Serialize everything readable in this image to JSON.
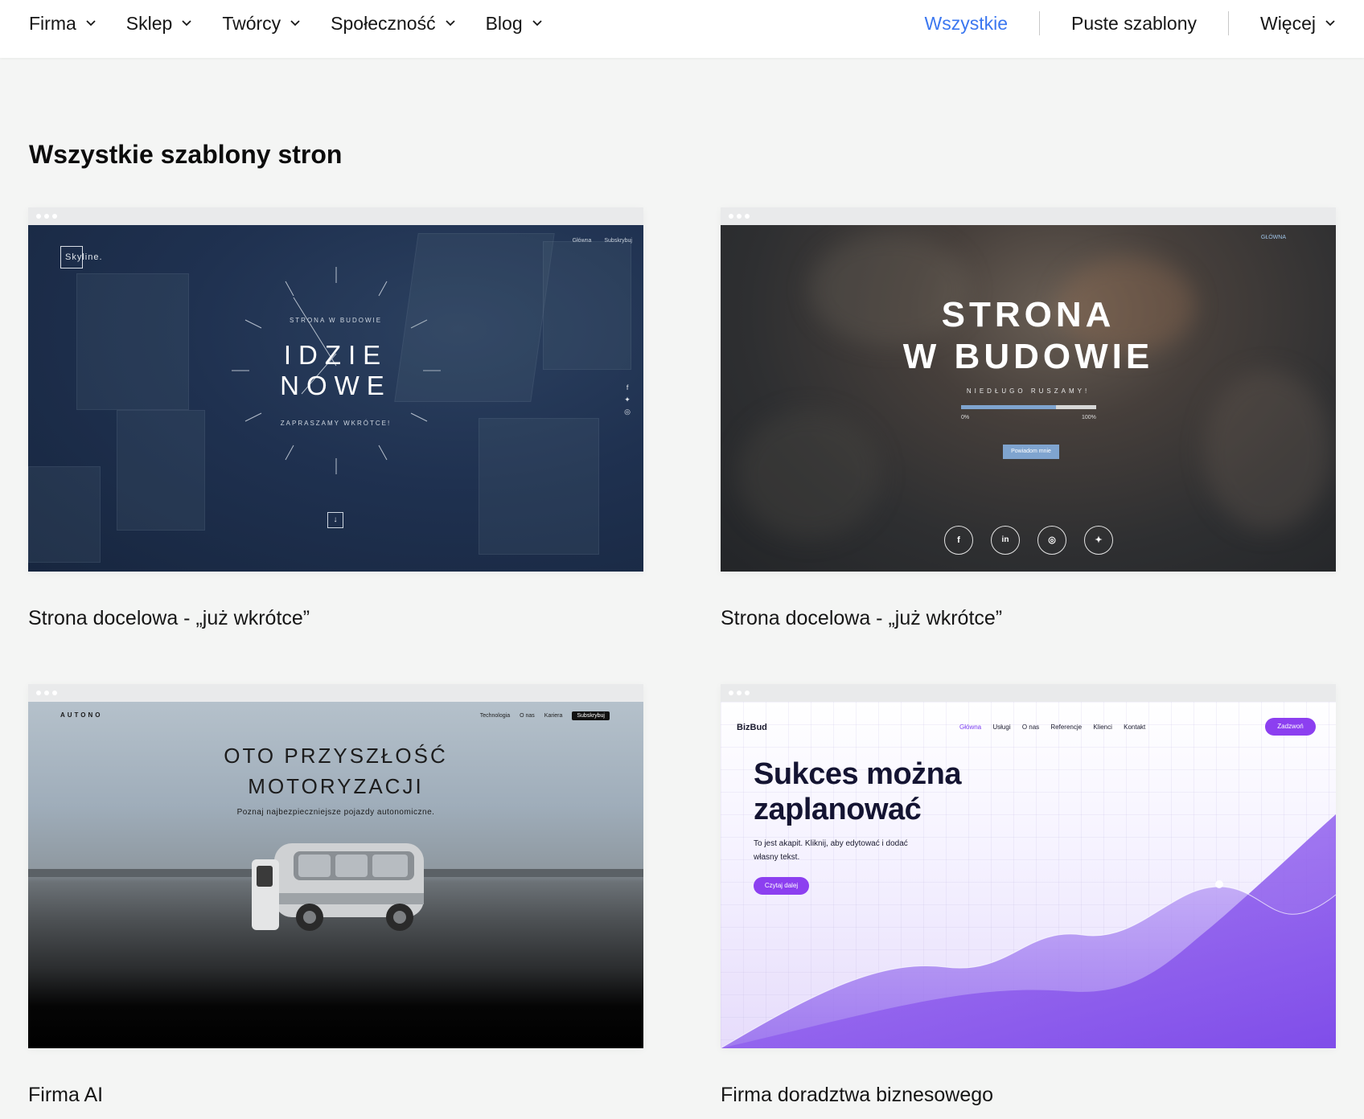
{
  "nav": {
    "left": [
      {
        "label": "Firma"
      },
      {
        "label": "Sklep"
      },
      {
        "label": "Twórcy"
      },
      {
        "label": "Społeczność"
      },
      {
        "label": "Blog"
      }
    ],
    "right": {
      "all": "Wszystkie",
      "blank": "Puste szablony",
      "more": "Więcej"
    },
    "active_color": "#3b77f0"
  },
  "page": {
    "title": "Wszystkie szablony stron"
  },
  "cards": [
    {
      "caption": "Strona docelowa - „już wkrótce”",
      "preview": {
        "logo": "Skyline.",
        "menu": [
          "Główna",
          "Subskrybuj"
        ],
        "kicker": "STRONA W BUDOWIE",
        "headline": [
          "IDZIE",
          "NOWE"
        ],
        "subline": "ZAPRASZAMY WKRÓTCE!",
        "social_icons": [
          "facebook-icon",
          "twitter-icon",
          "instagram-icon"
        ],
        "arrow": "↓"
      }
    },
    {
      "caption": "Strona docelowa - „już wkrótce”",
      "preview": {
        "menu": "GŁÓWNA",
        "headline": [
          "STRONA",
          "W BUDOWIE"
        ],
        "subline": "NIEDŁUGO RUSZAMY!",
        "progress": 0.7,
        "progress_min": "0%",
        "progress_max": "100%",
        "button": "Powiadom mnie",
        "social": [
          "f",
          "in",
          "◎",
          "🐦"
        ],
        "accent": "#7fa4cf"
      }
    },
    {
      "caption": "Firma AI",
      "preview": {
        "brand": "AUTONO",
        "menu": [
          "Technologia",
          "O nas",
          "Kariera"
        ],
        "menu_cta": "Subskrybuj",
        "headline": [
          "OTO PRZYSZŁOŚĆ",
          "MOTORYZACJI"
        ],
        "subline": "Poznaj najbezpieczniejsze pojazdy autonomiczne."
      }
    },
    {
      "caption": "Firma doradztwa biznesowego",
      "preview": {
        "brand": "BizBud",
        "menu": [
          "Główna",
          "Usługi",
          "O nas",
          "Referencje",
          "Klienci",
          "Kontakt"
        ],
        "cta": "Zadzwoń",
        "headline": [
          "Sukces można",
          "zaplanować"
        ],
        "text": "To jest akapit. Kliknij, aby edytować i dodać własny tekst.",
        "button": "Czytaj dalej",
        "accent": "#8c3ff0"
      }
    }
  ]
}
